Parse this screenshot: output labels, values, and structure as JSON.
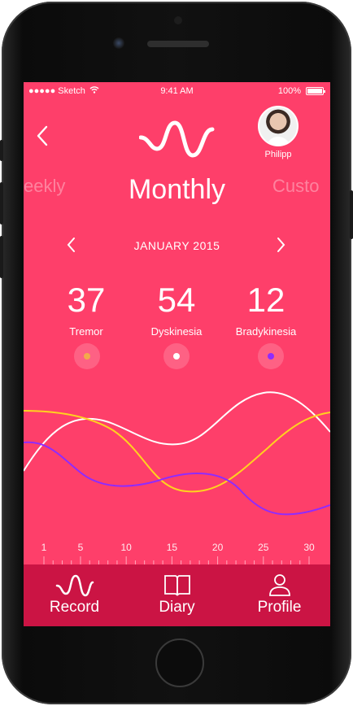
{
  "status_bar": {
    "carrier": "●●●●● Sketch",
    "time": "9:41 AM",
    "battery": "100%",
    "battery_level": 1.0
  },
  "header": {
    "user_name": "Philipp"
  },
  "periods": {
    "prev": "eekly",
    "current": "Monthly",
    "next": "Custo"
  },
  "month": {
    "label": "JANUARY 2015"
  },
  "stats": [
    {
      "value": "37",
      "label": "Tremor",
      "color": "#f3a94b"
    },
    {
      "value": "54",
      "label": "Dyskinesia",
      "color": "#ffffff"
    },
    {
      "value": "12",
      "label": "Bradykinesia",
      "color": "#8f2bff"
    }
  ],
  "chart_data": {
    "type": "line",
    "x": [
      1,
      5,
      10,
      15,
      20,
      25,
      30
    ],
    "series": [
      {
        "color": "#ffffff"
      },
      {
        "color": "#ffd21f"
      },
      {
        "color": "#8f2bff"
      }
    ]
  },
  "day_labels": [
    "1",
    "5",
    "10",
    "15",
    "20",
    "25",
    "30"
  ],
  "tabs": [
    {
      "label": "Record",
      "icon": "wave-icon"
    },
    {
      "label": "Diary",
      "icon": "book-icon"
    },
    {
      "label": "Profile",
      "icon": "person-icon"
    }
  ]
}
